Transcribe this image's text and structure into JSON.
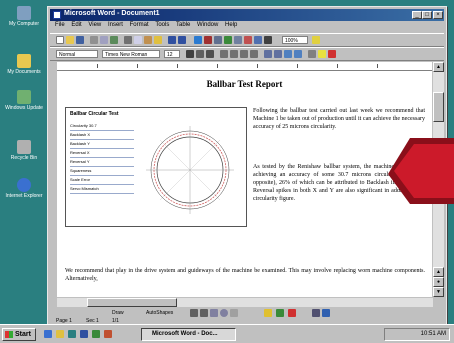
{
  "desktop": {
    "icons": [
      {
        "label": "My Computer",
        "color": "#7f9fc0"
      },
      {
        "label": "My Documents",
        "color": "#e8c850"
      },
      {
        "label": "Windows Update",
        "color": "#70b070"
      },
      {
        "label": "Recycle Bin",
        "color": "#b0b0b0"
      },
      {
        "label": "Internet Explorer",
        "color": "#3a70d0"
      }
    ]
  },
  "window": {
    "title": "Microsoft Word - Document1",
    "buttons": {
      "minimize": "_",
      "maximize": "□",
      "close": "×"
    }
  },
  "menu": {
    "items": [
      "File",
      "Edit",
      "View",
      "Insert",
      "Format",
      "Tools",
      "Table",
      "Window",
      "Help"
    ]
  },
  "formatting": {
    "style": "Normal",
    "font": "Times New Roman",
    "size": "12",
    "zoom": "100%"
  },
  "document": {
    "heading": "Ballbar Test Report",
    "paragraph1": "Following the ballbar test carried out last week we recommend that Machine 1 be taken out of production until it can achieve the necessary accuracy of 25 microns circularity.",
    "paragraph2": "As tested by the Renishaw ballbar system, the machine is currently achieving an accuracy of some 30.7 microns circularity (see plot opposite), 26% of which can be attributed to Backlash in the X axis. Reversal spikes in both X and Y are also significant in adding to this circularity figure.",
    "paragraph3": "We recommend that play in the drive system and guideways of the machine be examined. This may involve replacing worn machine components. Alternatively,",
    "figure": {
      "title": "Ballbar Circular Test",
      "lines": [
        "Circularity 30.7",
        "Backlash X",
        "Backlash Y",
        "Reversal X",
        "Reversal Y",
        "Squareness",
        "Scale Error",
        "Servo Mismatch"
      ]
    }
  },
  "drawing_toolbar": {
    "draw_label": "Draw",
    "autoshapes_label": "AutoShapes"
  },
  "status": {
    "page": "Page 1",
    "section": "Sec 1",
    "position": "1/1"
  },
  "taskbar": {
    "start_label": "Start",
    "task_label": "Microsoft Word - Doc...",
    "clock": "10:51 AM"
  },
  "accent": {
    "arrow": "#cc1a2a",
    "arrow_dark": "#8a0f1a"
  }
}
